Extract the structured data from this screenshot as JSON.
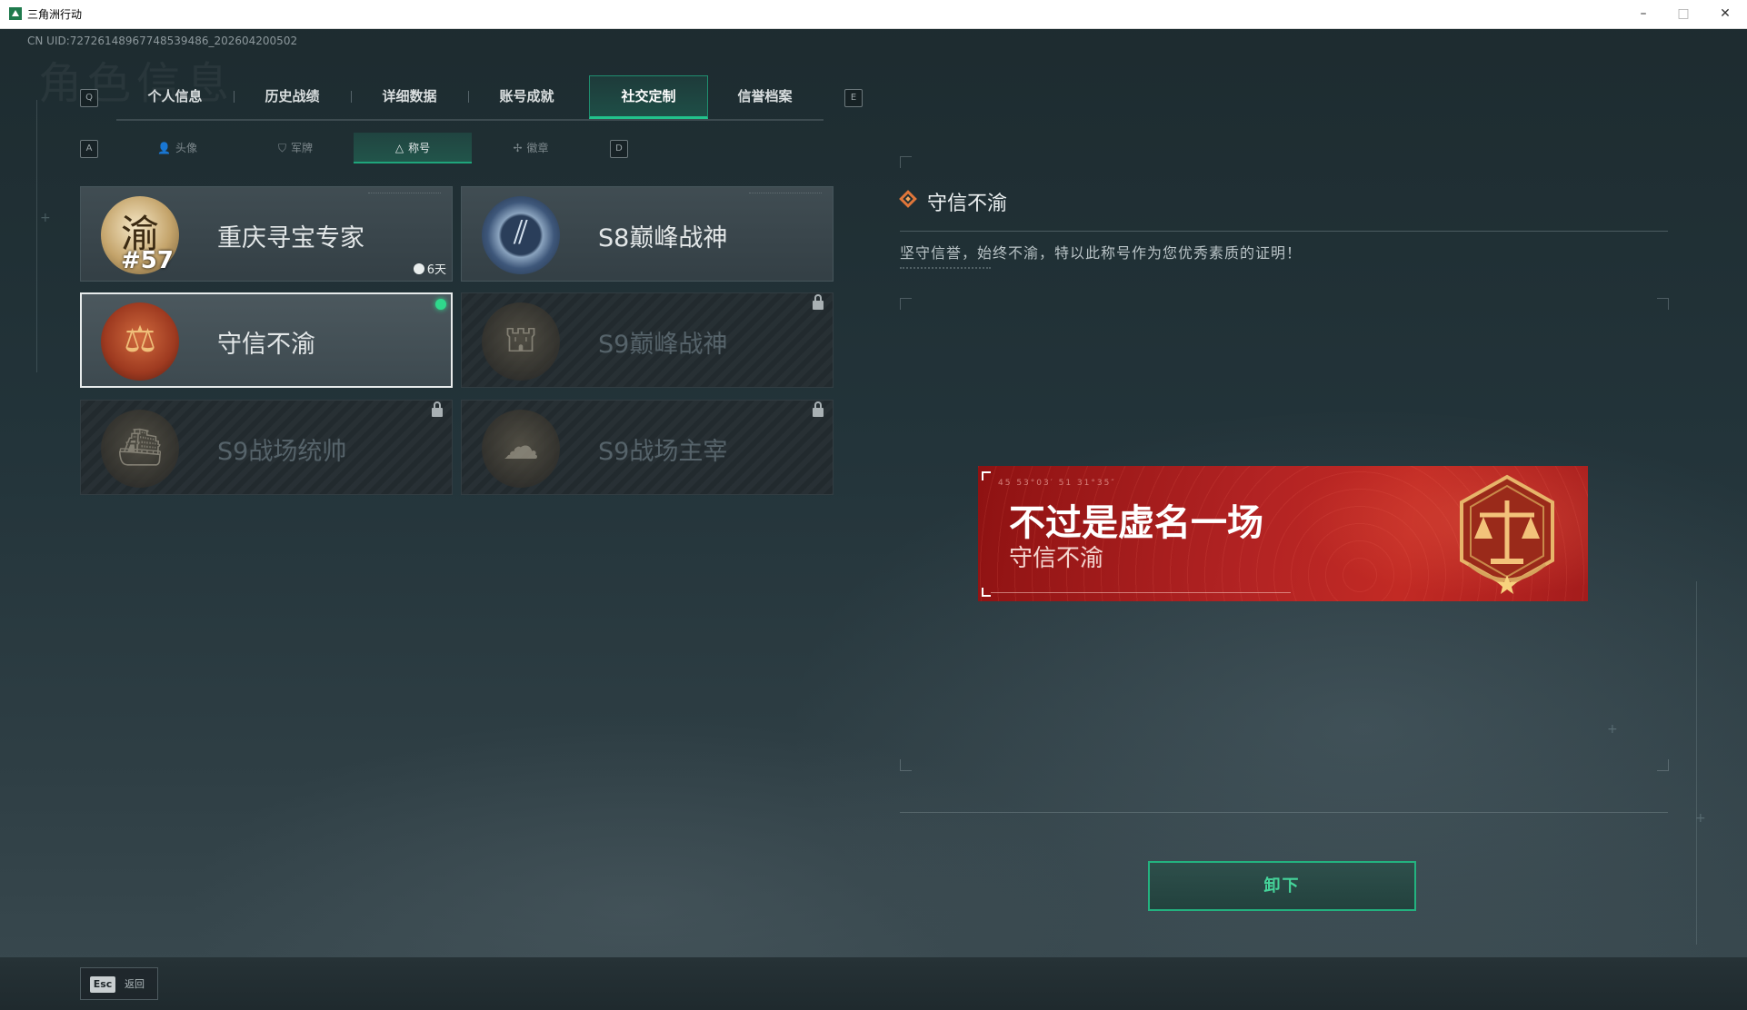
{
  "window": {
    "title": "三角洲行动",
    "min": "–",
    "max": "□",
    "close": "✕"
  },
  "uid": "CN UID:72726148967748539486_202604200502",
  "watermark": "角色信息",
  "main_tabs": {
    "left_key": "Q",
    "right_key": "E",
    "items": [
      "个人信息",
      "历史战绩",
      "详细数据",
      "账号成就",
      "社交定制",
      "信誉档案"
    ],
    "active": "社交定制"
  },
  "sub_tabs": {
    "left_key": "A",
    "right_key": "D",
    "items": [
      {
        "label": "头像",
        "icon": "person-icon",
        "glyph": "👤"
      },
      {
        "label": "军牌",
        "icon": "tag-icon",
        "glyph": "⛉"
      },
      {
        "label": "称号",
        "icon": "triangle-icon",
        "glyph": "△"
      },
      {
        "label": "徽章",
        "icon": "medal-icon",
        "glyph": "✢"
      }
    ],
    "active": "称号"
  },
  "titles": [
    {
      "label": "重庆寻宝专家",
      "emblem": "chongqing-emblem-icon",
      "emblem_char": "渝",
      "emblem_number": "#57",
      "timer": "6天",
      "state": "owned"
    },
    {
      "label": "S8巅峰战神",
      "emblem": "s8-peak-emblem-icon",
      "emblem_glyph": "⫽",
      "state": "owned"
    },
    {
      "label": "守信不渝",
      "emblem": "scales-emblem-icon",
      "emblem_glyph": "⚖",
      "state": "equipped"
    },
    {
      "label": "S9巅峰战神",
      "emblem": "s9-peak-emblem-icon",
      "emblem_glyph": "⛫",
      "state": "locked"
    },
    {
      "label": "S9战场统帅",
      "emblem": "warship-emblem-icon",
      "emblem_glyph": "⛴",
      "state": "locked"
    },
    {
      "label": "S9战场主宰",
      "emblem": "mushroom-cloud-emblem-icon",
      "emblem_glyph": "☁",
      "state": "locked"
    }
  ],
  "detail": {
    "title": "守信不渝",
    "description": "坚守信誉，始终不渝，特以此称号作为您优秀素质的证明！",
    "banner": {
      "main_text": "不过是虚名一场",
      "sub_text": "守信不渝",
      "code": "45 53°03′  51 31°35″",
      "badge_glyph": "⚖"
    }
  },
  "unequip_button": "卸下",
  "footer": {
    "esc_key": "Esc",
    "esc_label": "返回"
  },
  "colors": {
    "accent_green": "#22c28c",
    "banner_red": "#b22323",
    "diamond_orange": "#e0763a"
  }
}
